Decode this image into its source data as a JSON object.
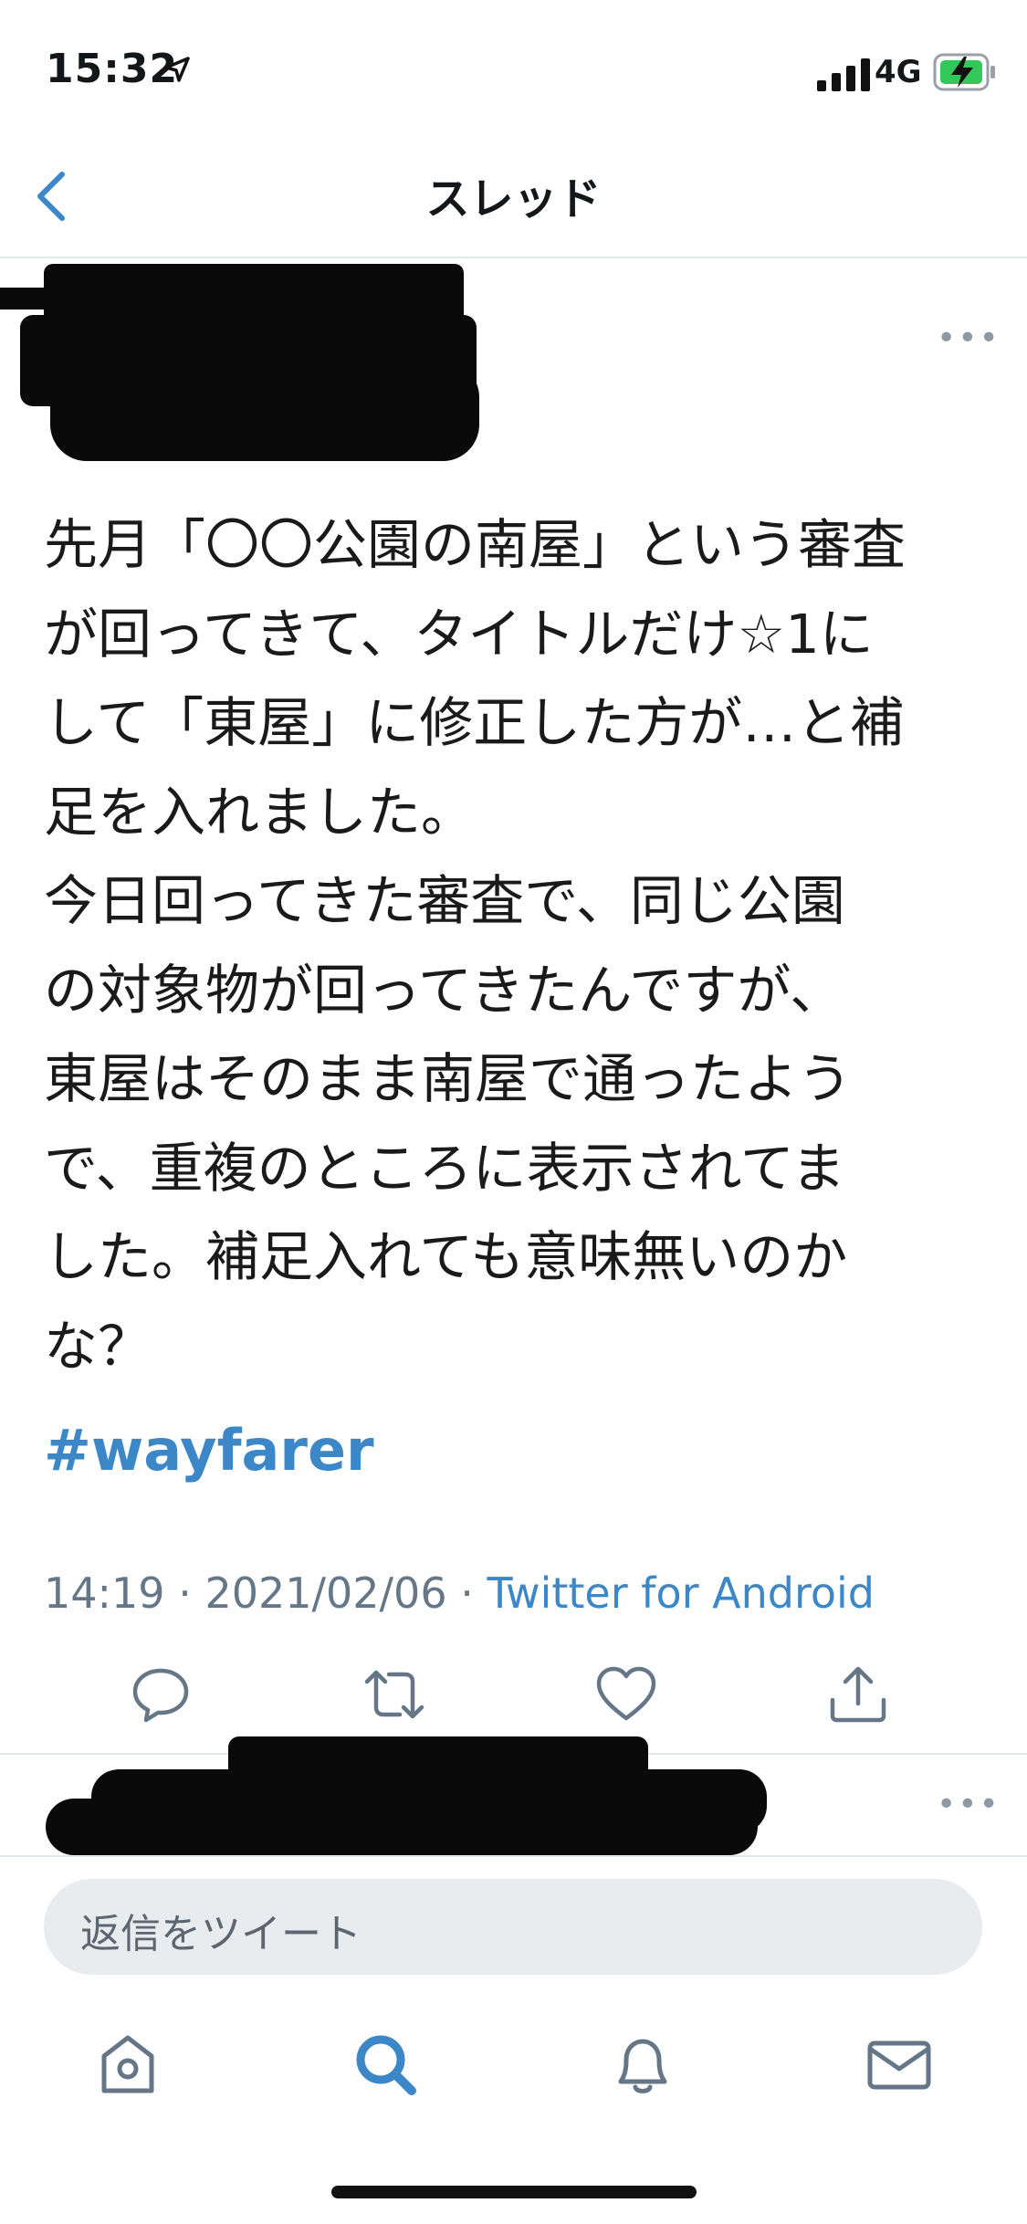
{
  "status_bar": {
    "time": "15:32",
    "network": "4G"
  },
  "nav": {
    "title": "スレッド"
  },
  "tweet": {
    "lines": [
      "先月「〇〇公園の南屋」という審査",
      "が回ってきて、タイトルだけ☆1に",
      "して「東屋」に修正した方が…と補",
      "足を入れました。",
      "今日回ってきた審査で、同じ公園",
      "の対象物が回ってきたんですが、",
      "東屋はそのまま南屋で通ったよう",
      "で、重複のところに表示されてま",
      "した。補足入れても意味無いのか",
      "な？"
    ],
    "hashtag": "#wayfarer",
    "time": "14:19",
    "date": "2021/02/06",
    "source": "Twitter for Android",
    "separator": " · "
  },
  "more_menu": "•••",
  "reply": {
    "placeholder": "返信をツイート"
  },
  "tab_bar": [
    "home-icon",
    "search-icon",
    "notifications-icon",
    "messages-icon"
  ],
  "colors": {
    "accent": "#3b87c8",
    "muted": "#657786",
    "icon": "#657786"
  }
}
